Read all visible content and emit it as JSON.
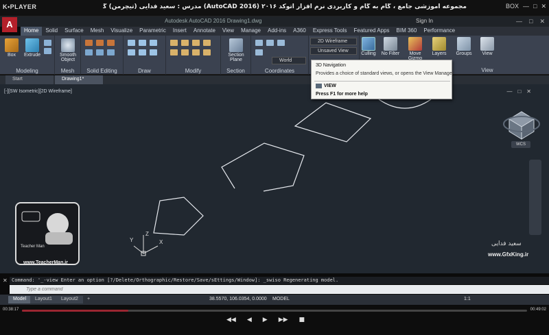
{
  "player": {
    "logo": "K•PLAYER",
    "title": "مجموعه آموزشی جامع ، گام به گام و کاربردی نرم افزار  اتوکد ۲۰۱۶ (AutoCAD 2016)  مدرس : سعید فدایی (تیچرمن) گروه آموزشی پادشاه گرافیست ها",
    "controls": [
      "BOX",
      "—",
      "□",
      "✕"
    ],
    "time_elapsed": "00:38:17",
    "time_total": "00:49:02",
    "progress": 0.21,
    "buttons": [
      "◀◀",
      "◀",
      "▶",
      "▶▶",
      "■"
    ]
  },
  "app": {
    "logo": "A",
    "title": "Autodesk AutoCAD 2016    Drawing1.dwg",
    "signin": "Sign In",
    "window_buttons": [
      "—",
      "□",
      "✕"
    ]
  },
  "ribbon": {
    "tabs": [
      "Home",
      "Solid",
      "Surface",
      "Mesh",
      "Visualize",
      "Parametric",
      "Insert",
      "Annotate",
      "View",
      "Manage",
      "Add-ins",
      "A360",
      "Express Tools",
      "Featured Apps",
      "BIM 360",
      "Performance"
    ],
    "active_tab": "Home",
    "panels": {
      "modeling": "Modeling",
      "mesh": "Mesh",
      "solid_editing": "Solid Editing",
      "draw": "Draw",
      "modify": "Modify",
      "section": "Section",
      "coordinates": "Coordinates",
      "view": "View"
    },
    "tools": {
      "box": "Box",
      "extrude": "Extrude",
      "smooth_object": "Smooth Object",
      "section_plane": "Section Plane",
      "culling": "Culling",
      "no_filter": "No Filter",
      "move_gizmo": "Move Gizmo",
      "layers": "Layers",
      "groups": "Groups",
      "view": "View"
    },
    "visual_style": "2D Wireframe",
    "named_view": "Unsaved View",
    "ucs": "World"
  },
  "tooltip": {
    "title": "3D Navigation",
    "description": "Provides a choice of standard views, or opens the View Manager",
    "command": "VIEW",
    "help": "Press F1 for more help"
  },
  "doc_tabs": [
    "Start",
    "Drawing1*"
  ],
  "viewport": {
    "label": "[-][SW Isometric][2D Wireframe]",
    "controls": [
      "—",
      "□",
      "✕"
    ],
    "wcs": "WCS",
    "axes": {
      "x": "X",
      "y": "Y",
      "z": "Z"
    }
  },
  "watermarks": {
    "teacher_name": "Teacher Man",
    "teacher_site": "www.TeacherMan.ir",
    "gfx_signature": "سعید فدایی",
    "gfx_site": "www.GfxKing.ir"
  },
  "command": {
    "history": "Command: '_-view Enter an option [?/Delete/Orthographic/Restore/Save/sEttings/Window]: _swiso Regenerating model.",
    "placeholder": "Type a command"
  },
  "status": {
    "layout_tabs": [
      "Model",
      "Layout1",
      "Layout2"
    ],
    "add_tab": "+",
    "coordinates": "38.5570, 106.0354, 0.0000",
    "space": "MODEL",
    "scale": "1:1"
  }
}
